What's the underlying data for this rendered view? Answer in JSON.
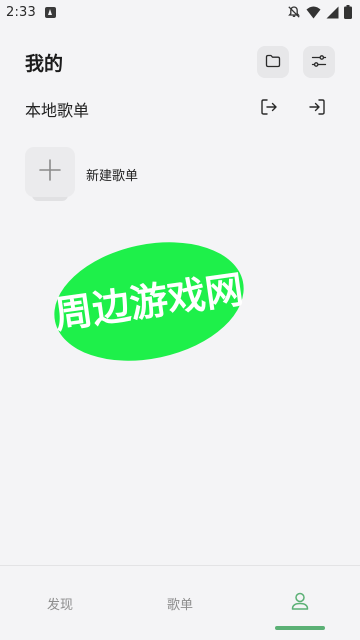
{
  "status_bar": {
    "time": "2:33"
  },
  "header": {
    "title": "我的"
  },
  "local_section": {
    "title": "本地歌单"
  },
  "new_playlist": {
    "label": "新建歌单"
  },
  "watermark": {
    "text": "周边游戏网",
    "color": "#1ef04a"
  },
  "bottom_nav": {
    "items": [
      {
        "label": "发现"
      },
      {
        "label": "歌单"
      },
      {
        "icon": "profile-icon",
        "active": true
      }
    ],
    "accent": "#5bb075"
  }
}
